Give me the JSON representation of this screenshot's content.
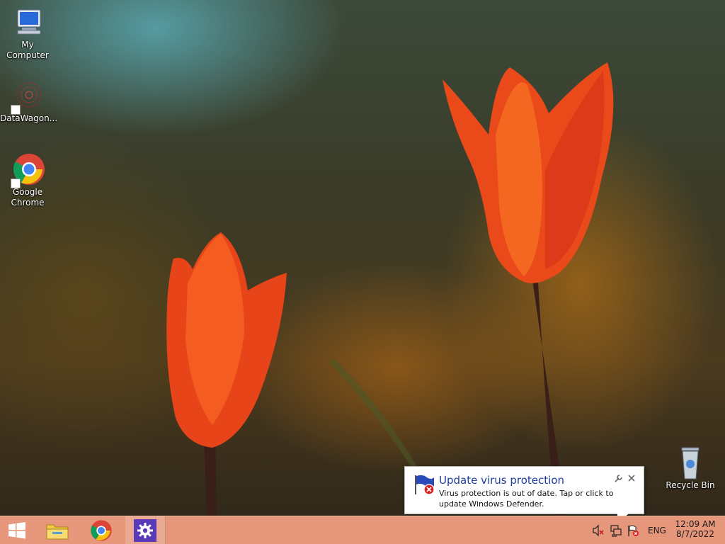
{
  "desktop": {
    "icons": [
      {
        "label": "My Computer",
        "icon": "computer-icon"
      },
      {
        "label": "DataWagon...",
        "icon": "datawagon-icon"
      },
      {
        "label": "Google\nChrome",
        "icon": "chrome-icon"
      },
      {
        "label": "Recycle Bin",
        "icon": "recycle-bin-icon"
      }
    ]
  },
  "notification": {
    "title": "Update virus protection",
    "message": "Virus protection is out of date. Tap or click to update Windows Defender.",
    "icon": "defender-warning-icon",
    "options_icon": "wrench-icon",
    "close_icon": "close-icon"
  },
  "taskbar": {
    "start_icon": "windows-logo-icon",
    "pinned": [
      {
        "name": "File Explorer",
        "icon": "file-explorer-icon"
      },
      {
        "name": "Google Chrome",
        "icon": "chrome-icon"
      },
      {
        "name": "Settings",
        "icon": "gear-icon",
        "active": true
      }
    ],
    "tray": {
      "language": "ENG",
      "time": "12:09 AM",
      "date": "8/7/2022",
      "icons": [
        "volume-muted-icon",
        "network-icon",
        "action-center-warning-icon"
      ]
    },
    "color": "#e6967a"
  }
}
